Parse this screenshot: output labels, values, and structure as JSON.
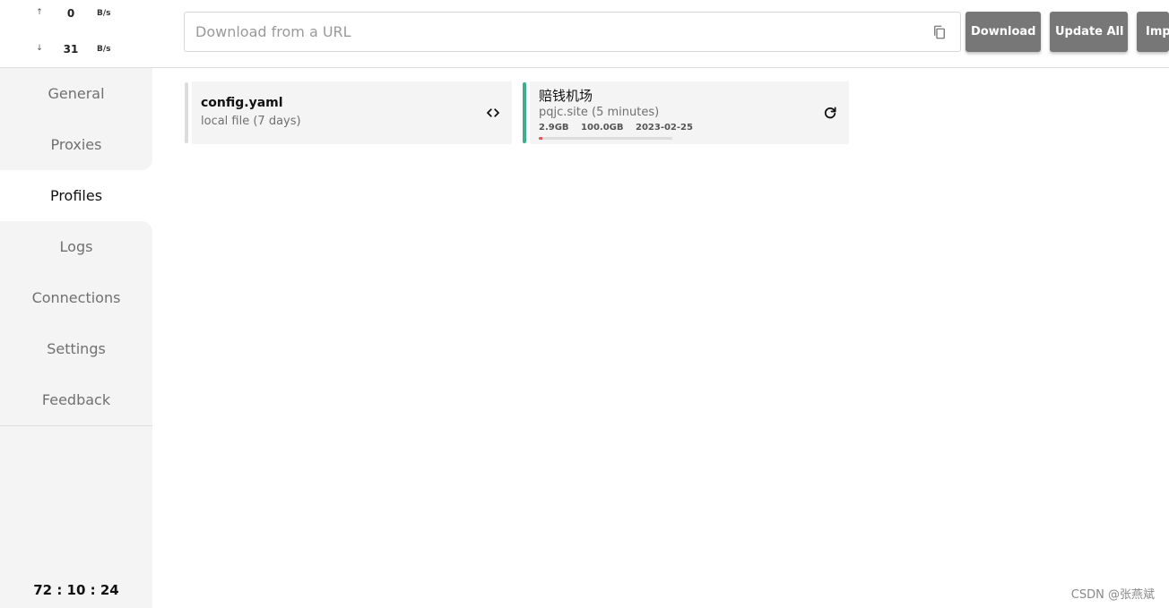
{
  "traffic": {
    "up": {
      "arrow": "↑",
      "value": "0",
      "unit": "B/s"
    },
    "down": {
      "arrow": "↓",
      "value": "31",
      "unit": "B/s"
    }
  },
  "nav": {
    "items": [
      {
        "label": "General",
        "active": false
      },
      {
        "label": "Proxies",
        "active": false
      },
      {
        "label": "Profiles",
        "active": true
      },
      {
        "label": "Logs",
        "active": false
      },
      {
        "label": "Connections",
        "active": false
      },
      {
        "label": "Settings",
        "active": false
      },
      {
        "label": "Feedback",
        "active": false
      }
    ]
  },
  "uptime": "72 : 10 : 24",
  "toolbar": {
    "url_placeholder": "Download from a URL",
    "url_value": "",
    "paste_icon": "clipboard-paste-icon",
    "download_label": "Download",
    "update_all_label": "Update All",
    "import_label": "Import"
  },
  "profiles": [
    {
      "name": "config.yaml",
      "subtitle": "local file (7 days)",
      "action_icon": "code-icon",
      "active": false
    },
    {
      "name": "赔钱机场",
      "subtitle": "pqjc.site (5 minutes)",
      "usage": {
        "used": "2.9GB",
        "total": "100.0GB",
        "expire": "2023-02-25"
      },
      "usage_fraction": 0.029,
      "action_icon": "refresh-icon",
      "active": true
    }
  ],
  "colors": {
    "sidebar_bg": "#f4f4f4",
    "active_profile_bar": "#3dae8a",
    "inactive_profile_bar": "#dcdcdc",
    "button_bg": "#777777",
    "usage_fill": "#e05a5a"
  },
  "watermark": "CSDN @张燕斌"
}
